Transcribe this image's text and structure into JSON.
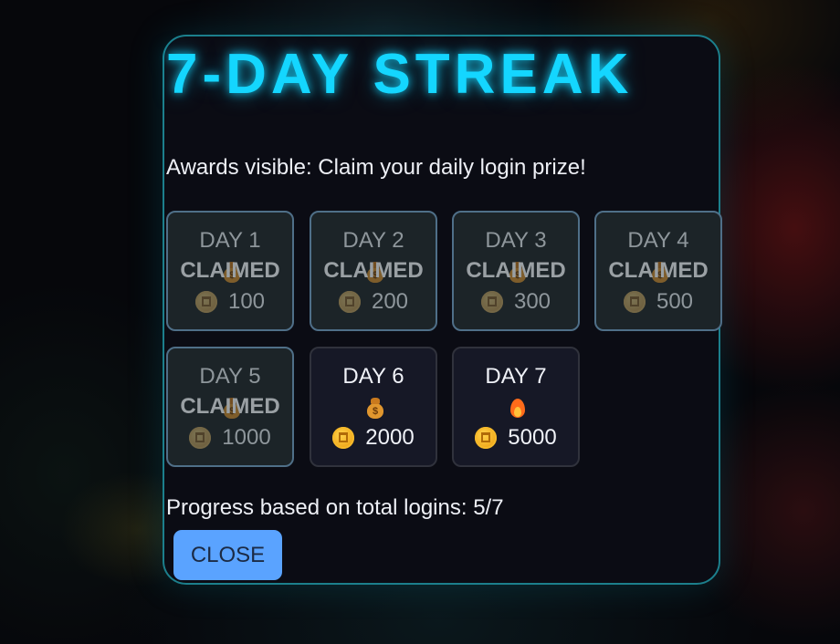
{
  "modal": {
    "title": "7-DAY STREAK",
    "subtitle": "Awards visible: Claim your daily login prize!",
    "progress_text": "Progress based on total logins: 5/7",
    "close_label": "CLOSE"
  },
  "days": [
    {
      "label": "DAY 1",
      "status": "CLAIMED",
      "reward": "100",
      "icon": "money-bag-icon",
      "claimed": true
    },
    {
      "label": "DAY 2",
      "status": "CLAIMED",
      "reward": "200",
      "icon": "money-bag-icon",
      "claimed": true
    },
    {
      "label": "DAY 3",
      "status": "CLAIMED",
      "reward": "300",
      "icon": "money-bag-icon",
      "claimed": true
    },
    {
      "label": "DAY 4",
      "status": "CLAIMED",
      "reward": "500",
      "icon": "money-bag-icon",
      "claimed": true
    },
    {
      "label": "DAY 5",
      "status": "CLAIMED",
      "reward": "1000",
      "icon": "money-bag-icon",
      "claimed": true
    },
    {
      "label": "DAY 6",
      "status": "",
      "reward": "2000",
      "icon": "money-bag-icon",
      "claimed": false
    },
    {
      "label": "DAY 7",
      "status": "",
      "reward": "5000",
      "icon": "fire-icon",
      "claimed": false
    }
  ],
  "colors": {
    "title": "#14d6ff",
    "modal_border": "#1c7f8c",
    "claimed_border": "#4f6f88",
    "button": "#5aa3ff"
  }
}
